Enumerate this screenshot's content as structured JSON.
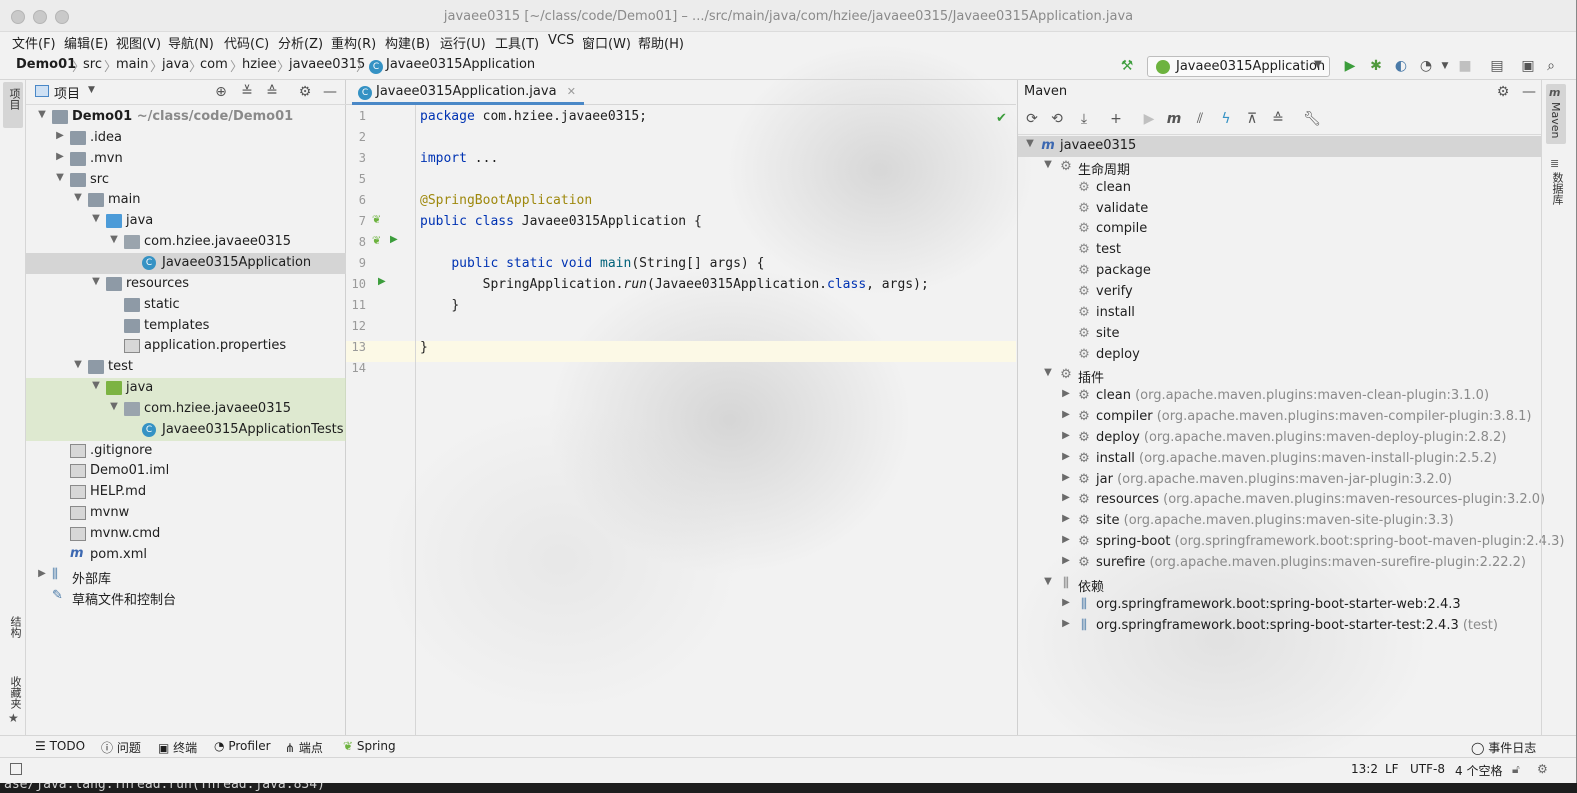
{
  "window": {
    "title": "javaee0315 [~/class/code/Demo01] – .../src/main/java/com/hziee/javaee0315/Javaee0315Application.java"
  },
  "menu": [
    "文件(F)",
    "编辑(E)",
    "视图(V)",
    "导航(N)",
    "代码(C)",
    "分析(Z)",
    "重构(R)",
    "构建(B)",
    "运行(U)",
    "工具(T)",
    "VCS",
    "窗口(W)",
    "帮助(H)"
  ],
  "breadcrumb": [
    "Demo01",
    "src",
    "main",
    "java",
    "com",
    "hziee",
    "javaee0315",
    "Javaee0315Application"
  ],
  "run_config": {
    "label": "Javaee0315Application"
  },
  "left_stripe": {
    "project": "项目",
    "structure": "结构",
    "favorites": "收藏夹"
  },
  "project_panel": {
    "title": "项目",
    "tree": [
      {
        "label": "Demo01",
        "hint": "~/class/code/Demo01",
        "indent": 0,
        "arrow": "down",
        "icon": "folder"
      },
      {
        "label": ".idea",
        "indent": 1,
        "arrow": "right",
        "icon": "folder"
      },
      {
        "label": ".mvn",
        "indent": 1,
        "arrow": "right",
        "icon": "folder"
      },
      {
        "label": "src",
        "indent": 1,
        "arrow": "down",
        "icon": "folder"
      },
      {
        "label": "main",
        "indent": 2,
        "arrow": "down",
        "icon": "folder"
      },
      {
        "label": "java",
        "indent": 3,
        "arrow": "down",
        "icon": "folder-blue"
      },
      {
        "label": "com.hziee.javaee0315",
        "indent": 4,
        "arrow": "down",
        "icon": "package"
      },
      {
        "label": "Javaee0315Application",
        "indent": 5,
        "arrow": "",
        "icon": "class",
        "selected": true
      },
      {
        "label": "resources",
        "indent": 3,
        "arrow": "down",
        "icon": "folder"
      },
      {
        "label": "static",
        "indent": 4,
        "arrow": "",
        "icon": "folder"
      },
      {
        "label": "templates",
        "indent": 4,
        "arrow": "",
        "icon": "folder"
      },
      {
        "label": "application.properties",
        "indent": 4,
        "arrow": "",
        "icon": "properties"
      },
      {
        "label": "test",
        "indent": 2,
        "arrow": "down",
        "icon": "folder"
      },
      {
        "label": "java",
        "indent": 3,
        "arrow": "down",
        "icon": "folder-green",
        "test": true
      },
      {
        "label": "com.hziee.javaee0315",
        "indent": 4,
        "arrow": "down",
        "icon": "package",
        "test": true
      },
      {
        "label": "Javaee0315ApplicationTests",
        "indent": 5,
        "arrow": "",
        "icon": "class",
        "test": true
      },
      {
        "label": ".gitignore",
        "indent": 1,
        "arrow": "",
        "icon": "file"
      },
      {
        "label": "Demo01.iml",
        "indent": 1,
        "arrow": "",
        "icon": "file"
      },
      {
        "label": "HELP.md",
        "indent": 1,
        "arrow": "",
        "icon": "md"
      },
      {
        "label": "mvnw",
        "indent": 1,
        "arrow": "",
        "icon": "file"
      },
      {
        "label": "mvnw.cmd",
        "indent": 1,
        "arrow": "",
        "icon": "file"
      },
      {
        "label": "pom.xml",
        "indent": 1,
        "arrow": "",
        "icon": "maven"
      },
      {
        "label": "外部库",
        "indent": 0,
        "arrow": "right",
        "icon": "library"
      },
      {
        "label": "草稿文件和控制台",
        "indent": 0,
        "arrow": "",
        "icon": "scratch"
      }
    ]
  },
  "editor": {
    "tab": "Javaee0315Application.java",
    "lines": [
      "1",
      "2",
      "3",
      "5",
      "6",
      "7",
      "8",
      "9",
      "10",
      "11",
      "12",
      "13",
      "14"
    ],
    "code": {
      "l1_kw": "package",
      "l1_rest": " com.hziee.javaee0315;",
      "l3_kw": "import",
      "l3_rest": " ...",
      "l6_ann": "@SpringBootApplication",
      "l7_kw": "public class",
      "l7_rest": " Javaee0315Application ",
      "l7_brace": "{",
      "l9_kw": "public static void",
      "l9_fn": "main",
      "l9_rest": "(String[] args) {",
      "l10_a": "SpringApplication.",
      "l10_run": "run",
      "l10_b": "(Javaee0315Application.",
      "l10_cls": "class",
      "l10_c": ", args);",
      "l11": "}",
      "l13": "}"
    }
  },
  "maven_panel": {
    "title": "Maven",
    "tree": [
      {
        "label": "javaee0315",
        "indent": 0,
        "arrow": "down",
        "icon": "project"
      },
      {
        "label": "生命周期",
        "indent": 1,
        "arrow": "down",
        "icon": "lifecycle"
      },
      {
        "label": "clean",
        "indent": 2,
        "arrow": "",
        "icon": "gear"
      },
      {
        "label": "validate",
        "indent": 2,
        "arrow": "",
        "icon": "gear"
      },
      {
        "label": "compile",
        "indent": 2,
        "arrow": "",
        "icon": "gear"
      },
      {
        "label": "test",
        "indent": 2,
        "arrow": "",
        "icon": "gear"
      },
      {
        "label": "package",
        "indent": 2,
        "arrow": "",
        "icon": "gear"
      },
      {
        "label": "verify",
        "indent": 2,
        "arrow": "",
        "icon": "gear"
      },
      {
        "label": "install",
        "indent": 2,
        "arrow": "",
        "icon": "gear"
      },
      {
        "label": "site",
        "indent": 2,
        "arrow": "",
        "icon": "gear"
      },
      {
        "label": "deploy",
        "indent": 2,
        "arrow": "",
        "icon": "gear"
      },
      {
        "label": "插件",
        "indent": 1,
        "arrow": "down",
        "icon": "plugins"
      },
      {
        "label": "clean",
        "hint": "(org.apache.maven.plugins:maven-clean-plugin:3.1.0)",
        "indent": 2,
        "arrow": "right",
        "icon": "plugin"
      },
      {
        "label": "compiler",
        "hint": "(org.apache.maven.plugins:maven-compiler-plugin:3.8.1)",
        "indent": 2,
        "arrow": "right",
        "icon": "plugin"
      },
      {
        "label": "deploy",
        "hint": "(org.apache.maven.plugins:maven-deploy-plugin:2.8.2)",
        "indent": 2,
        "arrow": "right",
        "icon": "plugin"
      },
      {
        "label": "install",
        "hint": "(org.apache.maven.plugins:maven-install-plugin:2.5.2)",
        "indent": 2,
        "arrow": "right",
        "icon": "plugin"
      },
      {
        "label": "jar",
        "hint": "(org.apache.maven.plugins:maven-jar-plugin:3.2.0)",
        "indent": 2,
        "arrow": "right",
        "icon": "plugin"
      },
      {
        "label": "resources",
        "hint": "(org.apache.maven.plugins:maven-resources-plugin:3.2.0)",
        "indent": 2,
        "arrow": "right",
        "icon": "plugin"
      },
      {
        "label": "site",
        "hint": "(org.apache.maven.plugins:maven-site-plugin:3.3)",
        "indent": 2,
        "arrow": "right",
        "icon": "plugin"
      },
      {
        "label": "spring-boot",
        "hint": "(org.springframework.boot:spring-boot-maven-plugin:2.4.3)",
        "indent": 2,
        "arrow": "right",
        "icon": "plugin"
      },
      {
        "label": "surefire",
        "hint": "(org.apache.maven.plugins:maven-surefire-plugin:2.22.2)",
        "indent": 2,
        "arrow": "right",
        "icon": "plugin"
      },
      {
        "label": "依赖",
        "indent": 1,
        "arrow": "down",
        "icon": "deps"
      },
      {
        "label": "org.springframework.boot:spring-boot-starter-web:2.4.3",
        "indent": 2,
        "arrow": "right",
        "icon": "dep"
      },
      {
        "label": "org.springframework.boot:spring-boot-starter-test:2.4.3",
        "hint": "(test)",
        "indent": 2,
        "arrow": "right",
        "icon": "dep"
      }
    ]
  },
  "right_stripe": {
    "maven": "Maven",
    "database": "数据库"
  },
  "bottom_tools": [
    "TODO",
    "问题",
    "终端",
    "Profiler",
    "端点",
    "Spring"
  ],
  "event_log": "事件日志",
  "status": {
    "position": "13:2",
    "line_sep": "LF",
    "encoding": "UTF-8",
    "indent": "4 个空格"
  },
  "terminal_peek": "ase/java.lang.Thread.run(Thread.java:834)",
  "colors": {
    "accent": "#4a88c7",
    "keyword": "#0033b3",
    "annotation": "#9e880d",
    "run_green": "#3c9d3c"
  }
}
